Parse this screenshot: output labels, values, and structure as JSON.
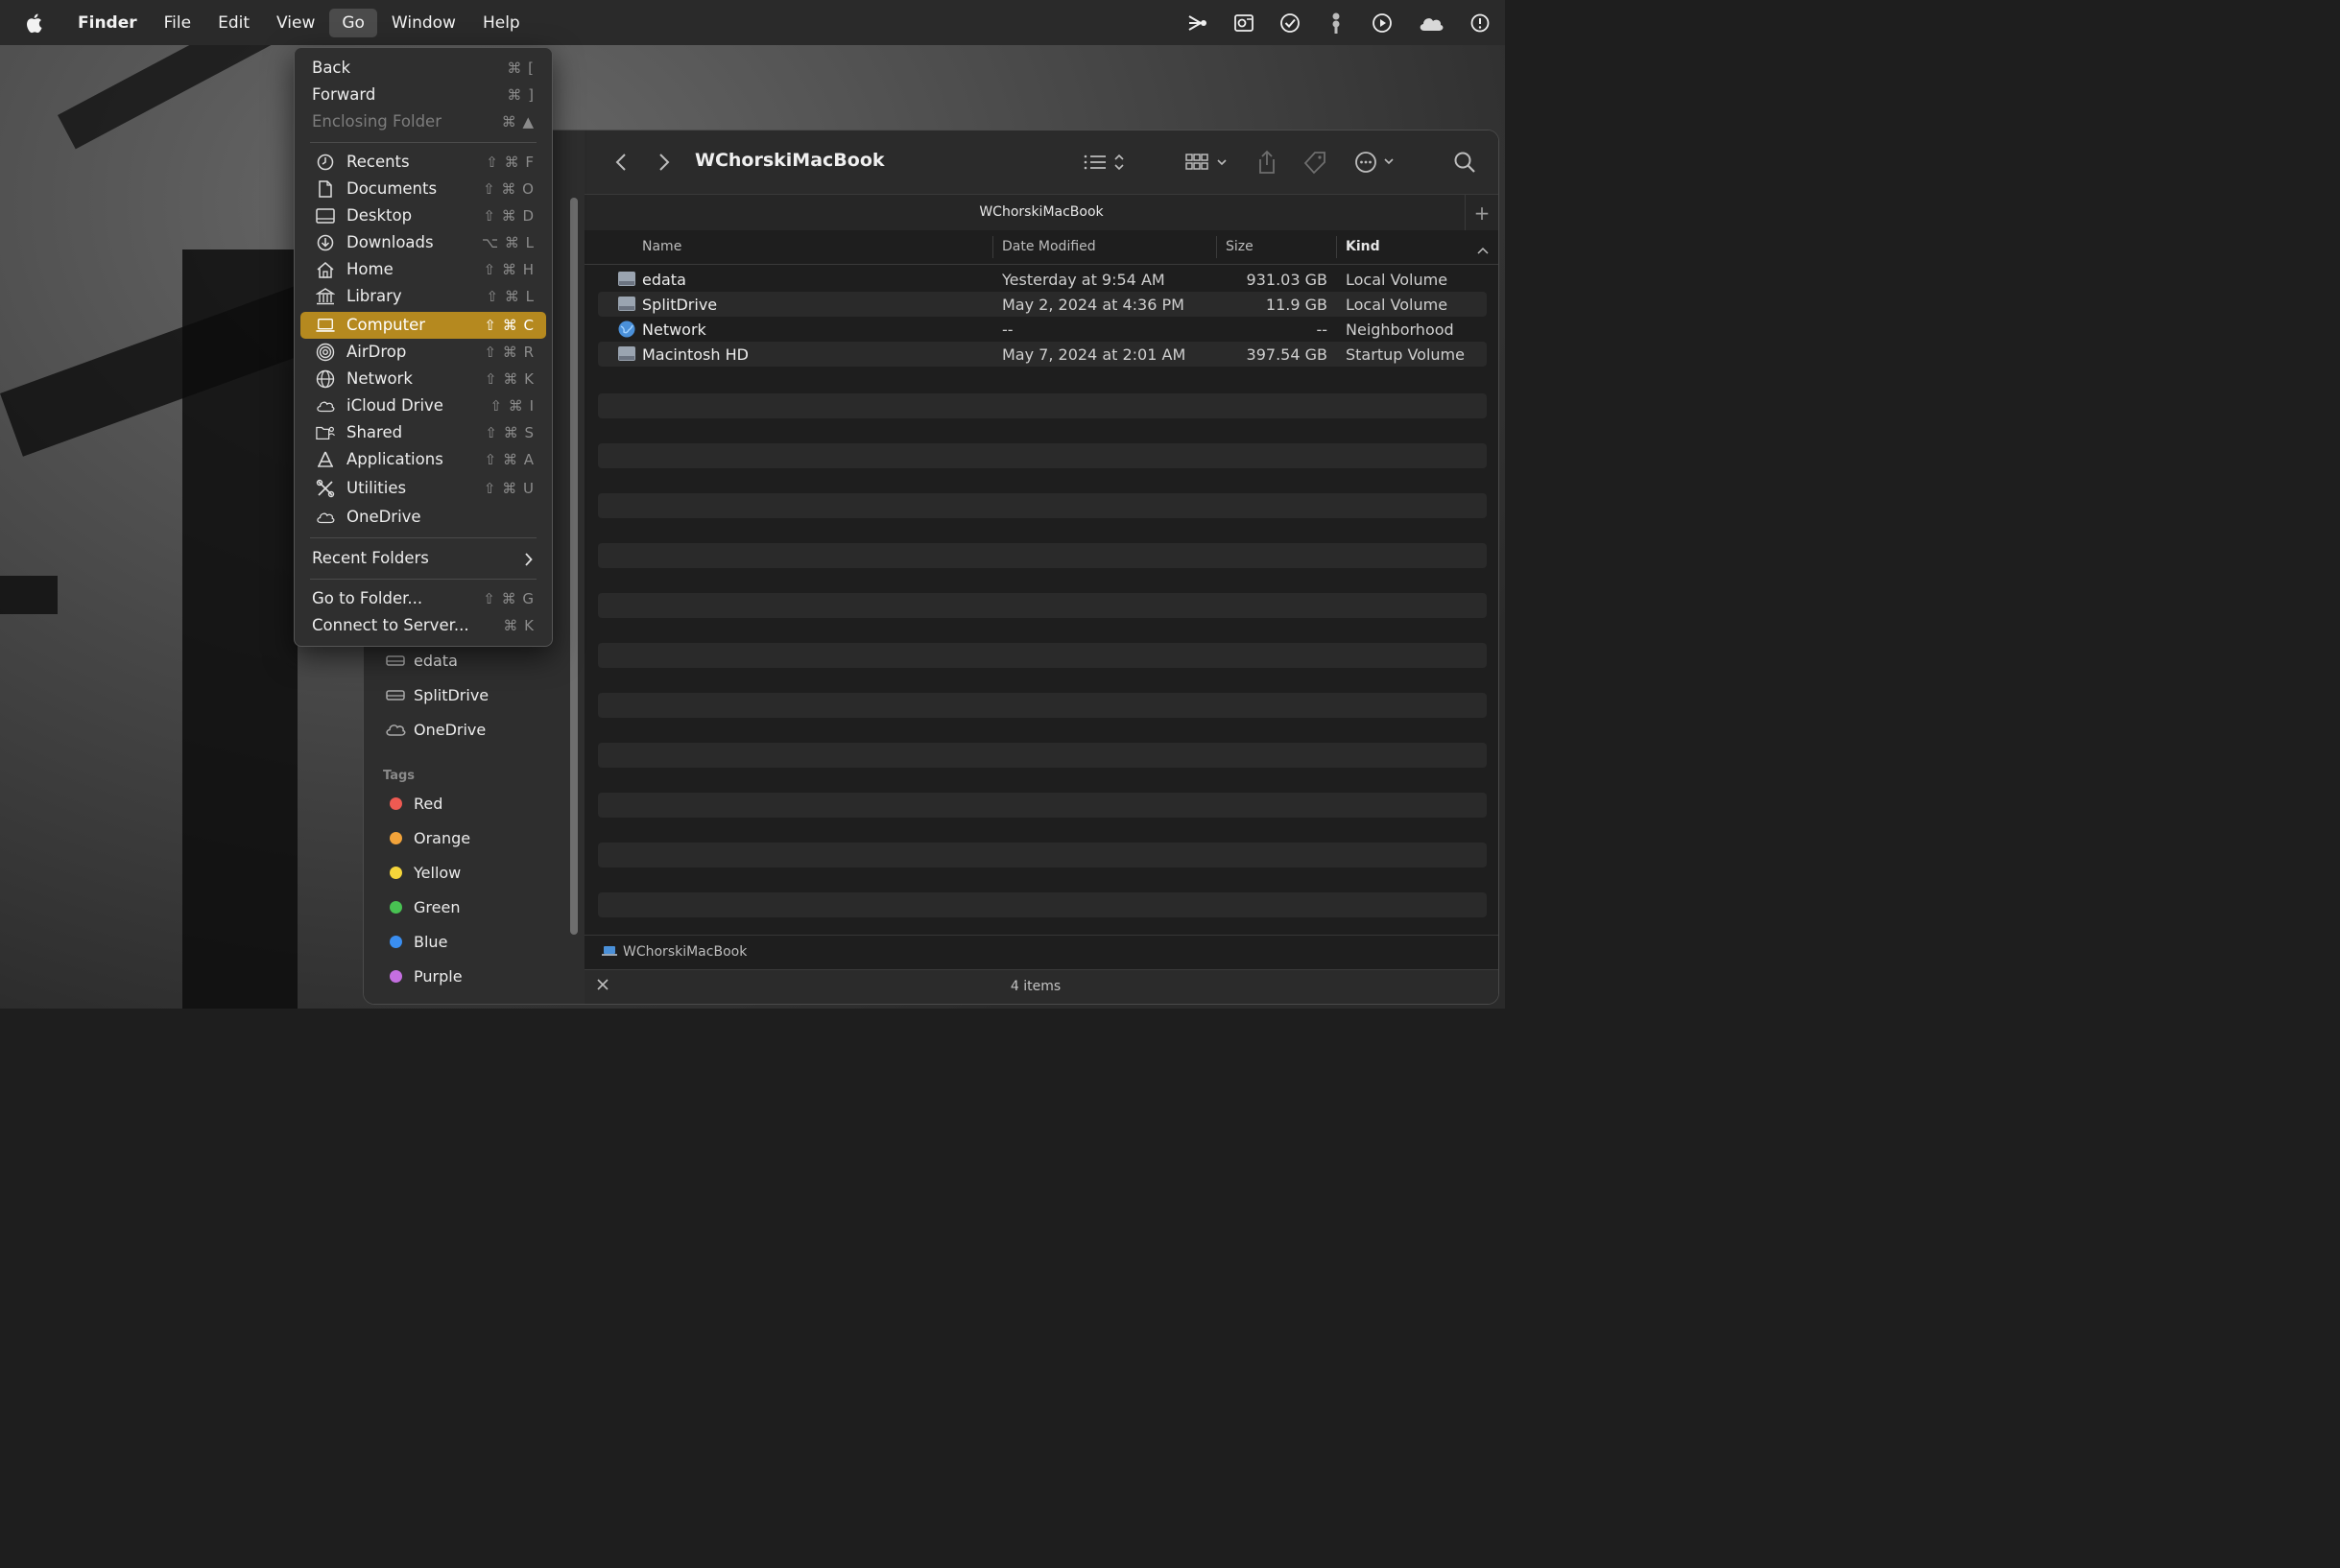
{
  "menubar": {
    "app_name": "Finder",
    "items": [
      "File",
      "Edit",
      "View",
      "Go",
      "Window",
      "Help"
    ],
    "active": "Go"
  },
  "status_icons": [
    "share-arrow-icon",
    "outlook-icon",
    "checkmark-circle-icon",
    "tuning-fork-icon",
    "play-circle-icon",
    "cloud-icon",
    "alert-clock-icon"
  ],
  "go_menu": {
    "group1": [
      {
        "label": "Back",
        "shortcut": "⌘ [",
        "disabled": false
      },
      {
        "label": "Forward",
        "shortcut": "⌘ ]",
        "disabled": false
      },
      {
        "label": "Enclosing Folder",
        "shortcut": "⌘ ▲",
        "disabled": true
      }
    ],
    "group2": [
      {
        "label": "Recents",
        "shortcut": "⇧ ⌘ F",
        "icon": "clock-icon"
      },
      {
        "label": "Documents",
        "shortcut": "⇧ ⌘ O",
        "icon": "document-icon"
      },
      {
        "label": "Desktop",
        "shortcut": "⇧ ⌘ D",
        "icon": "desktop-icon"
      },
      {
        "label": "Downloads",
        "shortcut": "⌥ ⌘ L",
        "icon": "download-icon"
      },
      {
        "label": "Home",
        "shortcut": "⇧ ⌘ H",
        "icon": "home-icon"
      },
      {
        "label": "Library",
        "shortcut": "⇧ ⌘ L",
        "icon": "library-icon"
      },
      {
        "label": "Computer",
        "shortcut": "⇧ ⌘ C",
        "icon": "laptop-icon",
        "selected": true
      },
      {
        "label": "AirDrop",
        "shortcut": "⇧ ⌘ R",
        "icon": "airdrop-icon"
      },
      {
        "label": "Network",
        "shortcut": "⇧ ⌘ K",
        "icon": "globe-icon"
      },
      {
        "label": "iCloud Drive",
        "shortcut": "⇧ ⌘ I",
        "icon": "cloud-icon"
      },
      {
        "label": "Shared",
        "shortcut": "⇧ ⌘ S",
        "icon": "shared-folder-icon"
      },
      {
        "label": "Applications",
        "shortcut": "⇧ ⌘ A",
        "icon": "applications-icon"
      },
      {
        "label": "Utilities",
        "shortcut": "⇧ ⌘ U",
        "icon": "tools-icon"
      },
      {
        "label": "OneDrive",
        "shortcut": "",
        "icon": "cloud-icon"
      }
    ],
    "recent_folders": "Recent Folders",
    "group3": [
      {
        "label": "Go to Folder...",
        "shortcut": "⇧ ⌘ G"
      },
      {
        "label": "Connect to Server...",
        "shortcut": "⌘ K"
      }
    ]
  },
  "sidebar": {
    "locations": [
      {
        "label": "edata",
        "icon": "drive-icon"
      },
      {
        "label": "SplitDrive",
        "icon": "drive-icon"
      },
      {
        "label": "OneDrive",
        "icon": "cloud-icon"
      }
    ],
    "tags_heading": "Tags",
    "tags": [
      {
        "label": "Red",
        "color": "#ee5a52"
      },
      {
        "label": "Orange",
        "color": "#f2a33a"
      },
      {
        "label": "Yellow",
        "color": "#f5d53a"
      },
      {
        "label": "Green",
        "color": "#48c252"
      },
      {
        "label": "Blue",
        "color": "#3a8ef0"
      },
      {
        "label": "Purple",
        "color": "#c46fe0"
      }
    ]
  },
  "window": {
    "title": "WChorskiMacBook",
    "tab_title": "WChorskiMacBook",
    "columns": {
      "name": "Name",
      "date": "Date Modified",
      "size": "Size",
      "kind": "Kind"
    },
    "rows": [
      {
        "name": "edata",
        "date": "Yesterday at 9:54 AM",
        "size": "931.03 GB",
        "kind": "Local Volume",
        "icon": "drive-icon"
      },
      {
        "name": "SplitDrive",
        "date": "May 2, 2024 at 4:36 PM",
        "size": "11.9 GB",
        "kind": "Local Volume",
        "icon": "drive-icon"
      },
      {
        "name": "Network",
        "date": "--",
        "size": "--",
        "kind": "Neighborhood",
        "icon": "network-globe-icon"
      },
      {
        "name": "Macintosh HD",
        "date": "May 7, 2024 at 2:01 AM",
        "size": "397.54 GB",
        "kind": "Startup Volume",
        "icon": "drive-icon"
      }
    ],
    "path": "WChorskiMacBook",
    "item_count": "4 items"
  }
}
